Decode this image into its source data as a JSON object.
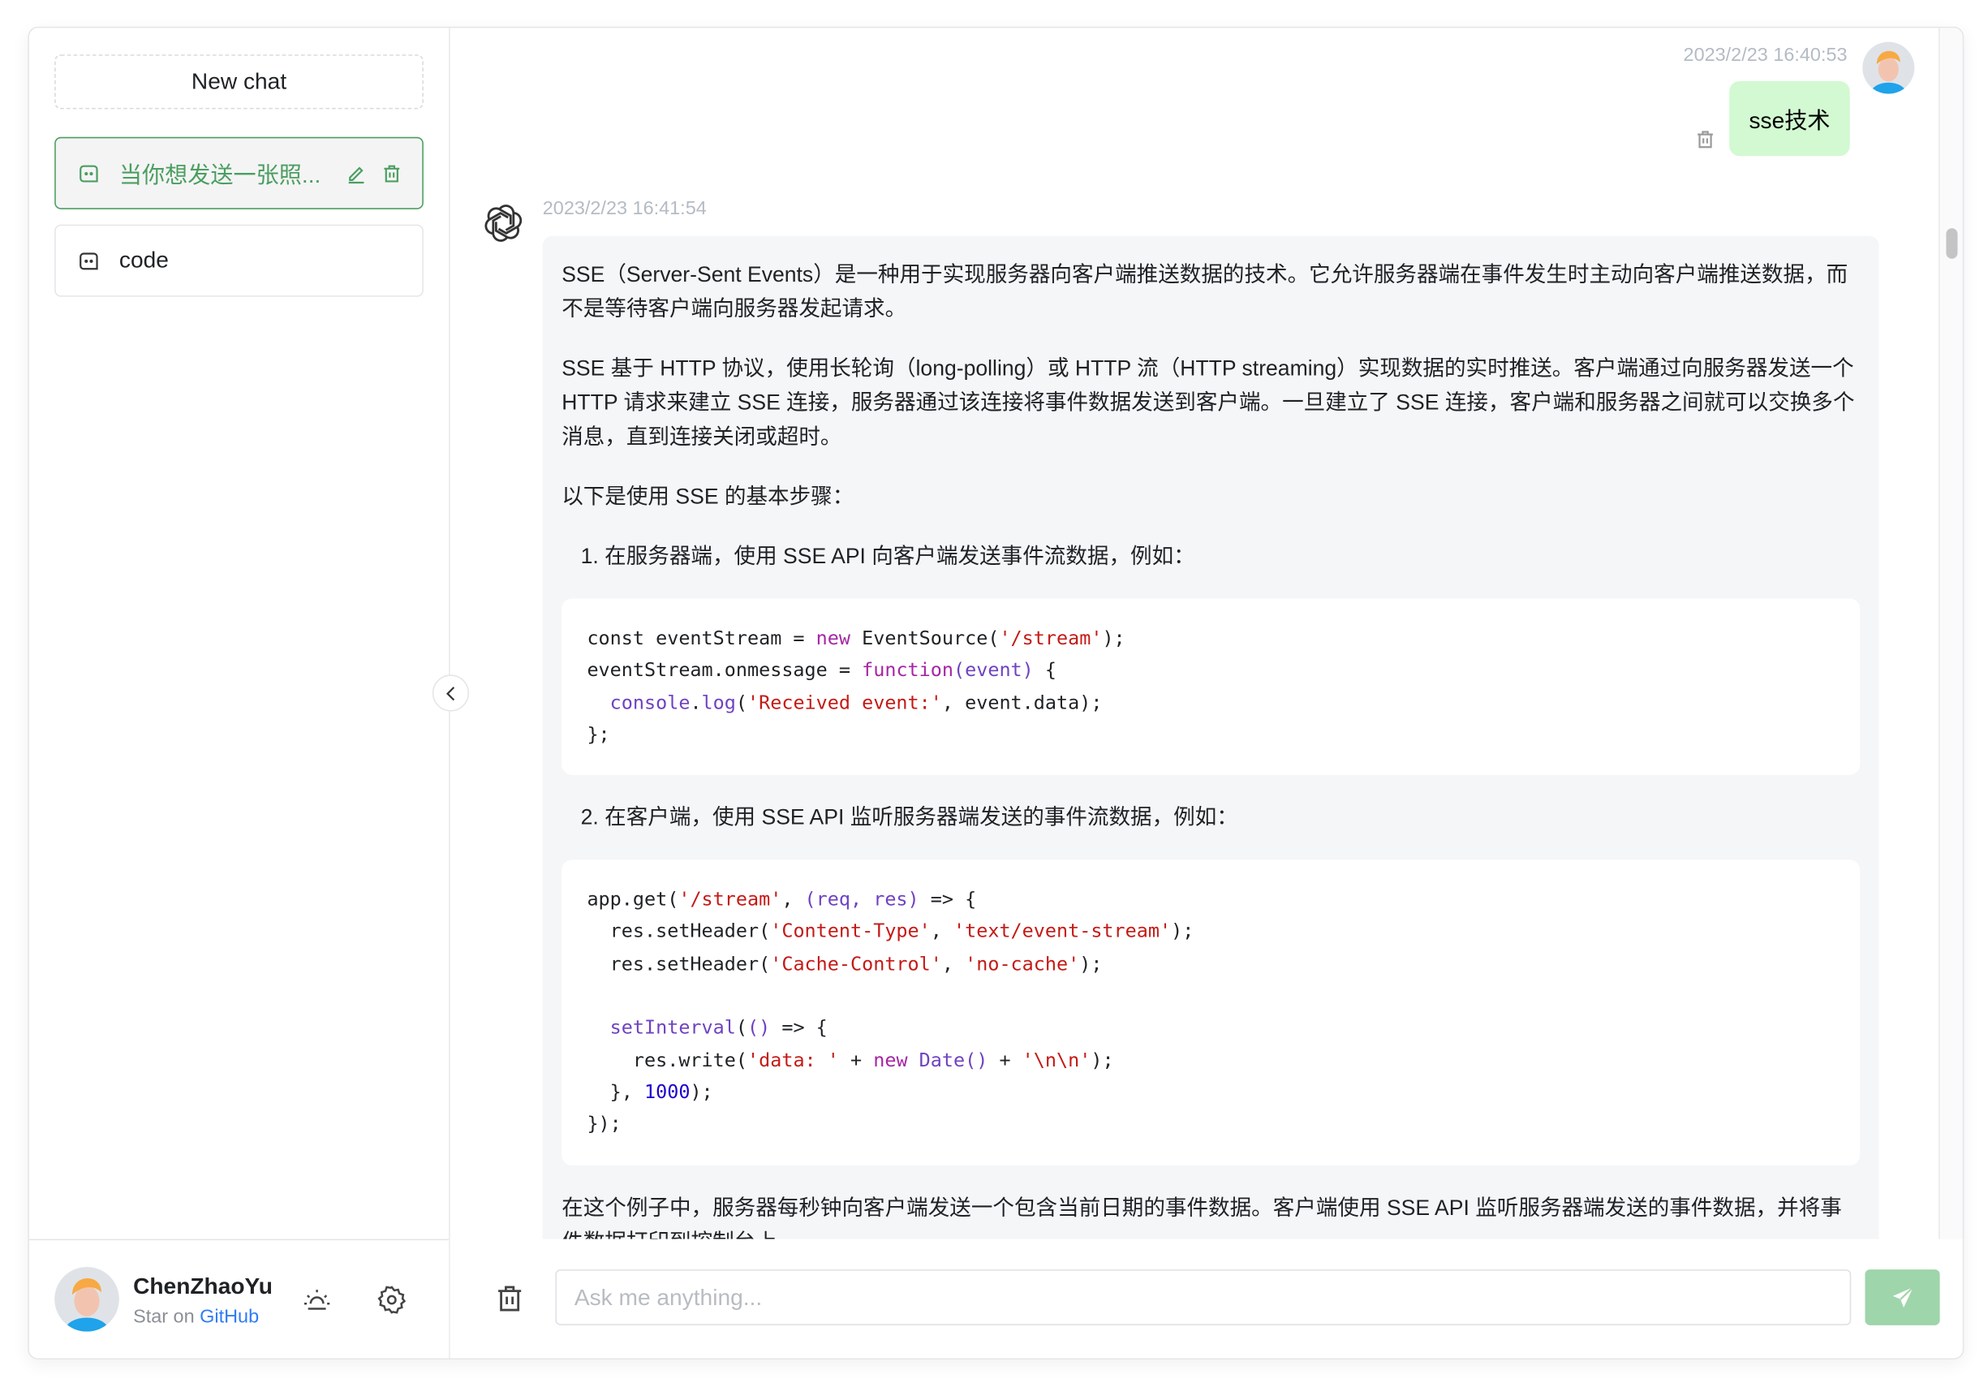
{
  "sidebar": {
    "new_chat_label": "New chat",
    "items": [
      {
        "label": "当你想发送一张照...",
        "icon": "chat-bubble-icon",
        "active": true
      },
      {
        "label": "code",
        "icon": "chat-bubble-icon",
        "active": false
      }
    ],
    "user": {
      "name": "ChenZhaoYu",
      "star_prefix": "Star on",
      "star_link": "GitHub"
    }
  },
  "colors": {
    "accent": "#4b9e5f",
    "user_bubble": "#d2f9d1",
    "assistant_bubble": "#f4f6f8",
    "send_button": "#9fd5ab",
    "link": "#2f7cf6"
  },
  "chat": {
    "user_message": {
      "timestamp": "2023/2/23 16:40:53",
      "text": "sse技术"
    },
    "assistant_message": {
      "timestamp": "2023/2/23 16:41:54",
      "p1": "SSE（Server-Sent Events）是一种用于实现服务器向客户端推送数据的技术。它允许服务器端在事件发生时主动向客户端推送数据，而不是等待客户端向服务器发起请求。",
      "p2": "SSE 基于 HTTP 协议，使用长轮询（long-polling）或 HTTP 流（HTTP streaming）实现数据的实时推送。客户端通过向服务器发送一个 HTTP 请求来建立 SSE 连接，服务器通过该连接将事件数据发送到客户端。一旦建立了 SSE 连接，客户端和服务器之间就可以交换多个消息，直到连接关闭或超时。",
      "p3": "以下是使用 SSE 的基本步骤：",
      "step1": "1. 在服务器端，使用 SSE API 向客户端发送事件流数据，例如：",
      "code1": [
        "const eventStream = new EventSource('/stream');",
        "eventStream.onmessage = function(event) {",
        "  console.log('Received event:', event.data);",
        "};"
      ],
      "step2": "2. 在客户端，使用 SSE API 监听服务器端发送的事件流数据，例如：",
      "code2": [
        "app.get('/stream', (req, res) => {",
        "  res.setHeader('Content-Type', 'text/event-stream');",
        "  res.setHeader('Cache-Control', 'no-cache');",
        "",
        "  setInterval(() => {",
        "    res.write('data: ' + new Date() + '\\n\\n');",
        "  }, 1000);",
        "});"
      ],
      "p4": "在这个例子中，服务器每秒钟向客户端发送一个包含当前日期的事件数据。客户端使用 SSE API 监听服务器端发送的事件数据，并将事件数据打印到控制台上。"
    }
  },
  "composer": {
    "placeholder": "Ask me anything..."
  }
}
